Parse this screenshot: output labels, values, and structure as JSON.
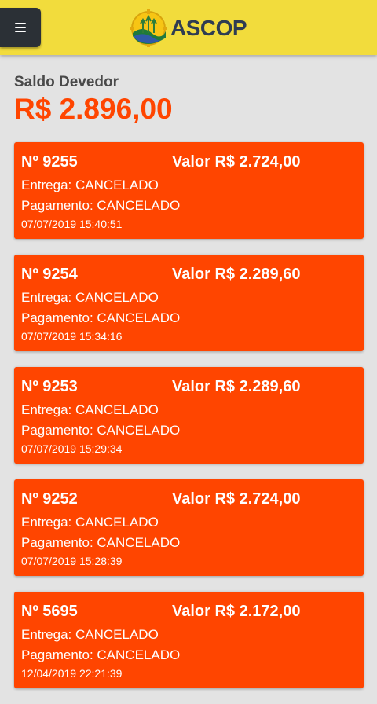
{
  "header": {
    "logo_text": "ASCOP",
    "colors": {
      "bar": "#f2dc3c",
      "menu_button": "#2b3036"
    },
    "menu_icon": "hamburger-menu-icon"
  },
  "balance": {
    "label": "Saldo Devedor",
    "value": "R$ 2.896,00",
    "color": "#ff4500"
  },
  "orders": [
    {
      "number": "Nº 9255",
      "valor": "Valor R$ 2.724,00",
      "entrega": "Entrega: CANCELADO",
      "pagamento": "Pagamento: CANCELADO",
      "date": "07/07/2019 15:40:51"
    },
    {
      "number": "Nº 9254",
      "valor": "Valor R$ 2.289,60",
      "entrega": "Entrega: CANCELADO",
      "pagamento": "Pagamento: CANCELADO",
      "date": "07/07/2019 15:34:16"
    },
    {
      "number": "Nº 9253",
      "valor": "Valor R$ 2.289,60",
      "entrega": "Entrega: CANCELADO",
      "pagamento": "Pagamento: CANCELADO",
      "date": "07/07/2019 15:29:34"
    },
    {
      "number": "Nº 9252",
      "valor": "Valor R$ 2.724,00",
      "entrega": "Entrega: CANCELADO",
      "pagamento": "Pagamento: CANCELADO",
      "date": "07/07/2019 15:28:39"
    },
    {
      "number": "Nº 5695",
      "valor": "Valor R$ 2.172,00",
      "entrega": "Entrega: CANCELADO",
      "pagamento": "Pagamento: CANCELADO",
      "date": "12/04/2019 22:21:39"
    }
  ],
  "card_color": "#ff4500"
}
